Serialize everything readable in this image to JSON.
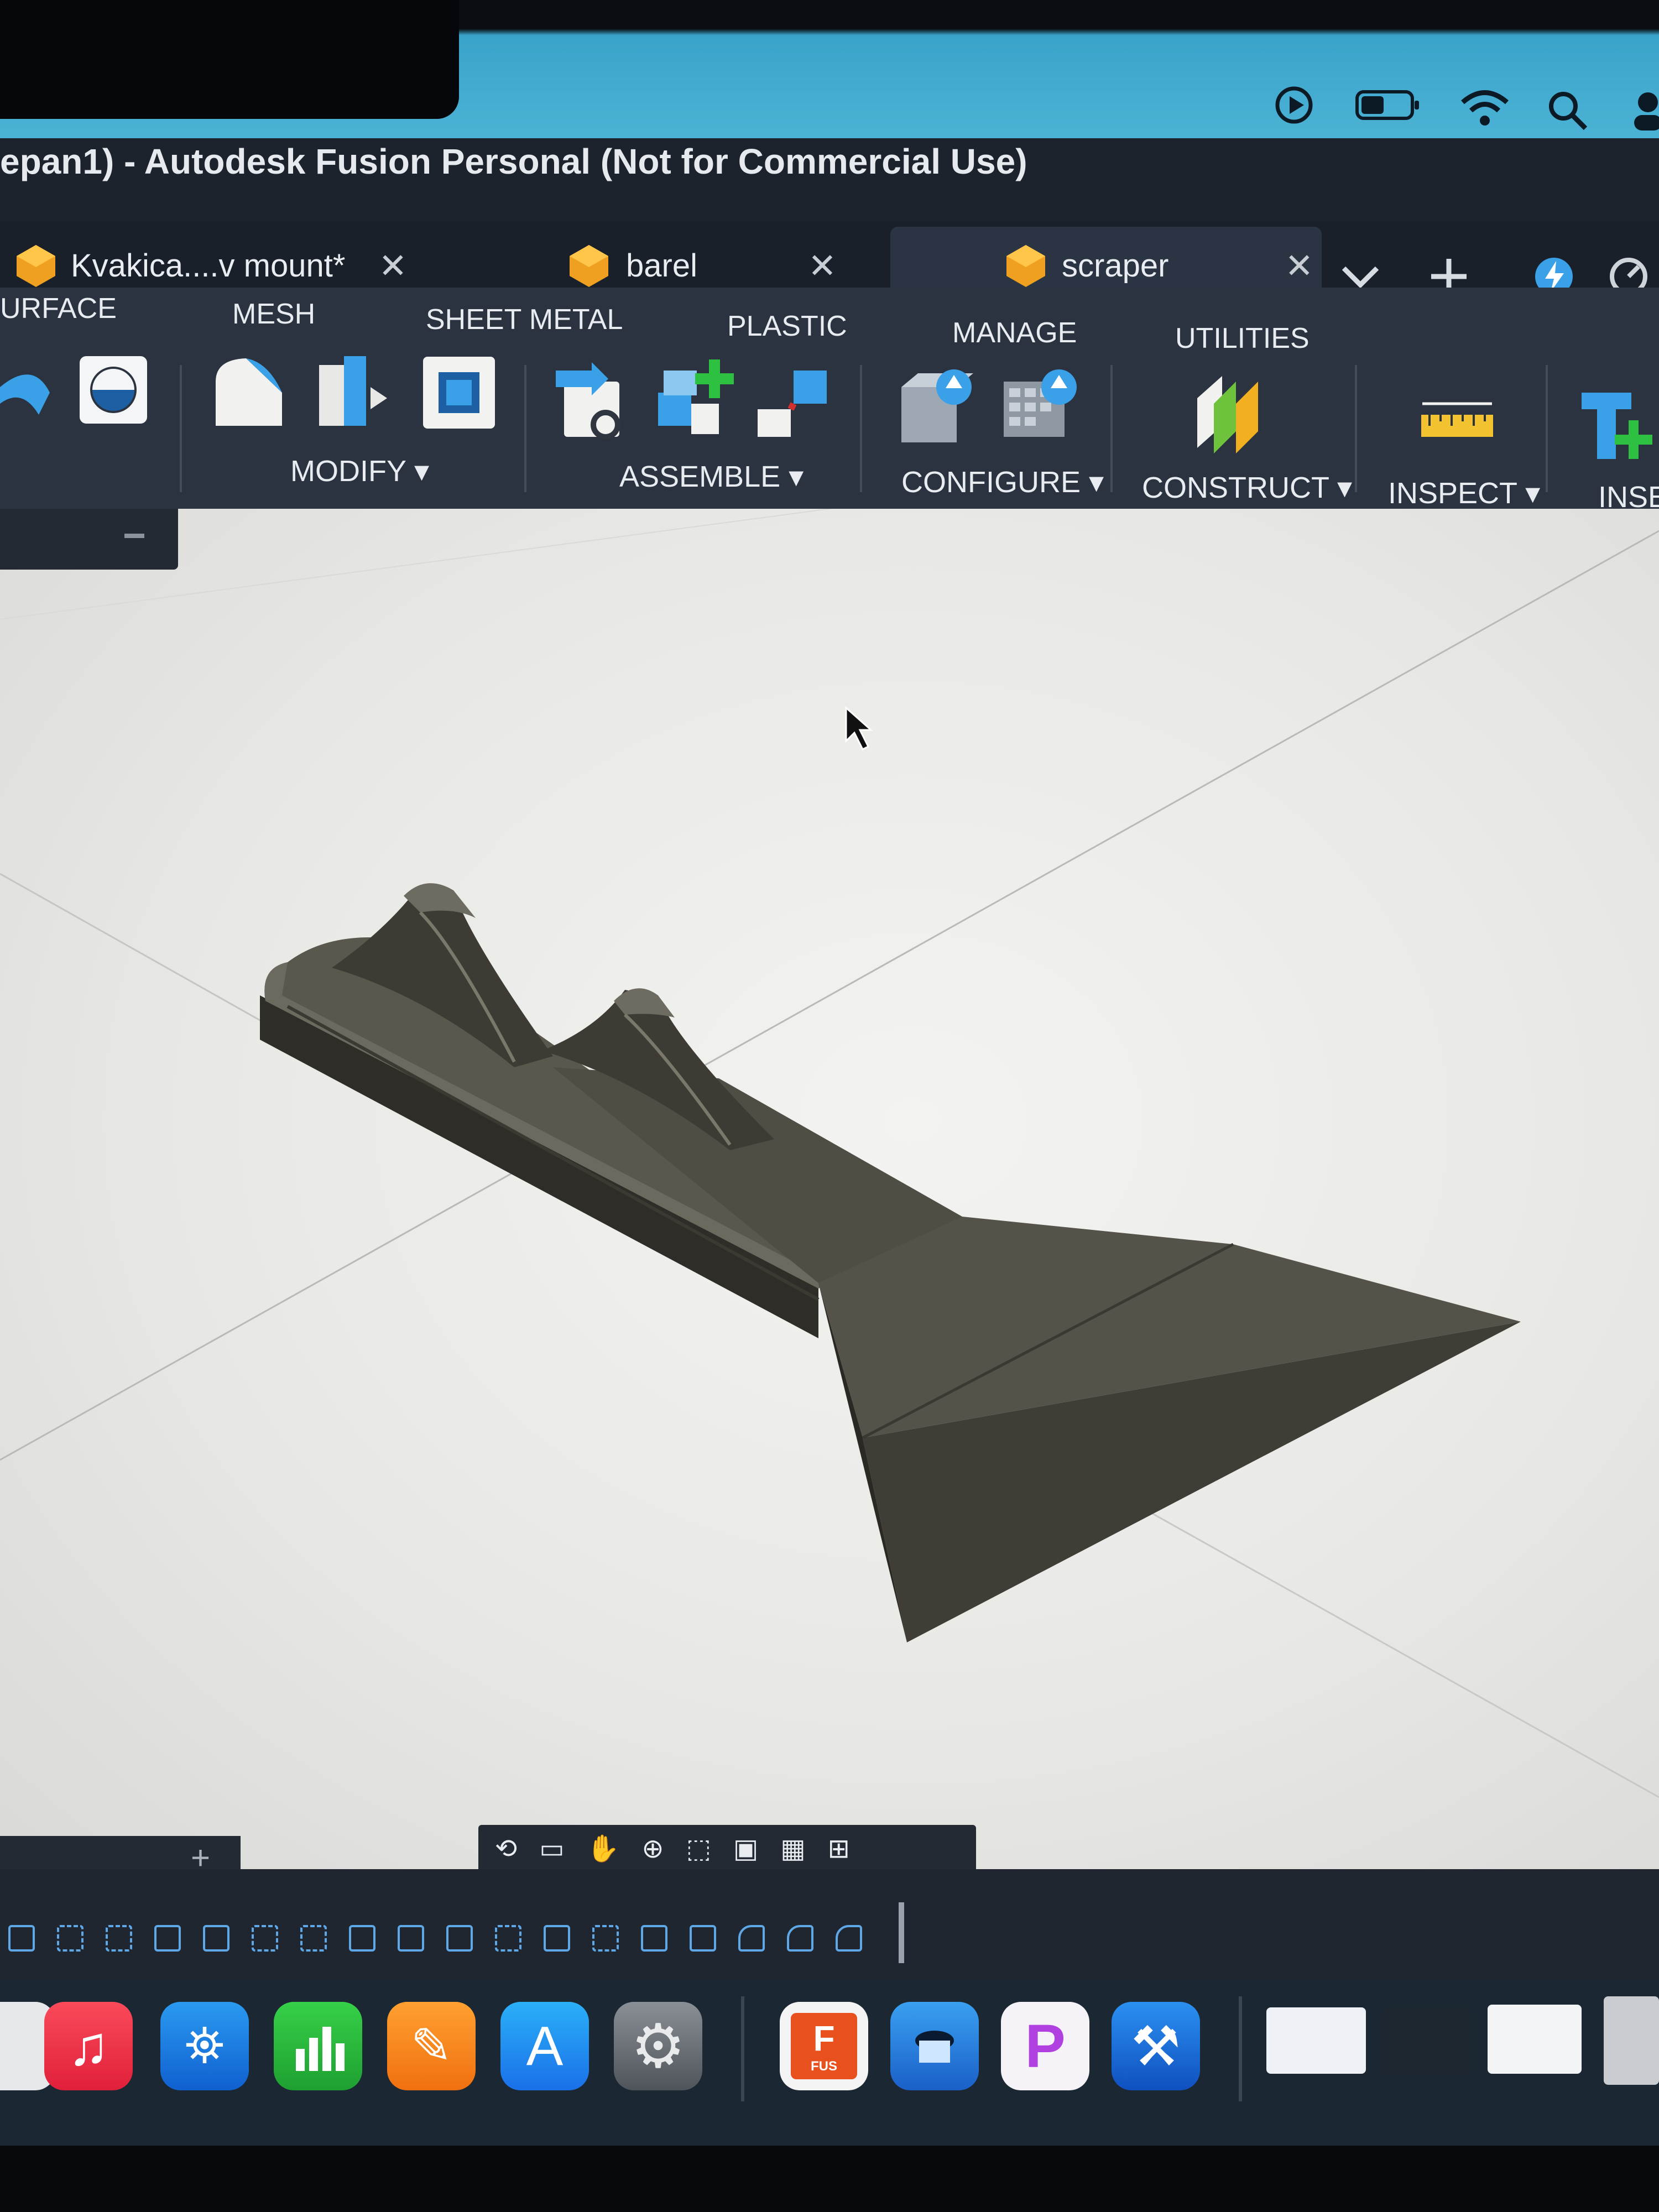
{
  "window": {
    "title": "epan1) - Autodesk Fusion Personal (Not for Commercial Use)"
  },
  "tabs": [
    {
      "label": "Kvakica....v mount*",
      "active": false
    },
    {
      "label": "barel",
      "active": false
    },
    {
      "label": "scraper",
      "active": true
    }
  ],
  "ribbon": {
    "categories": [
      "URFACE",
      "MESH",
      "SHEET METAL",
      "PLASTIC",
      "MANAGE",
      "UTILITIES"
    ],
    "groups": {
      "modify": "MODIFY",
      "assemble": "ASSEMBLE",
      "configure": "CONFIGURE",
      "construct": "CONSTRUCT",
      "inspect": "INSPECT",
      "insert": "INSEF"
    }
  },
  "status_icons": [
    "play-icon",
    "battery-icon",
    "wifi-icon",
    "search-icon",
    "user-icon"
  ],
  "dock": {
    "apps": [
      "Music",
      "Keynote",
      "Numbers",
      "Pages",
      "App Store",
      "System Settings",
      "Fusion",
      "Preview",
      "Pixelmator Pro",
      "Xcode"
    ],
    "fusion_badge": "FUS",
    "fusion_letter": "F"
  },
  "colors": {
    "accent": "#3aa0e8",
    "ribbon": "#2a333f",
    "viewport": "#ececea",
    "model": "#4a4840"
  }
}
